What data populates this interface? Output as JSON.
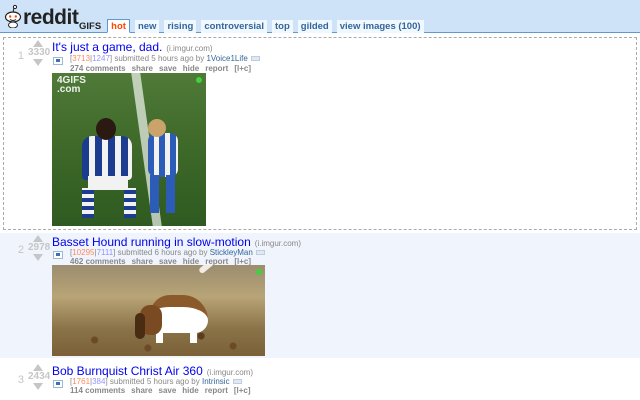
{
  "header": {
    "logo_text": "reddit",
    "subreddit": "GIFS",
    "tabs": [
      "hot",
      "new",
      "rising",
      "controversial",
      "top",
      "gilded",
      "view images (100)"
    ],
    "selected_tab": "hot"
  },
  "posts": [
    {
      "rank": "1",
      "score": "3330",
      "title": "It's just a game, dad.",
      "domain": "(i.imgur.com)",
      "ups": "3713",
      "downs": "1247",
      "submitted": "submitted 5 hours ago by",
      "author": "1Voice1Life",
      "comments": "274 comments",
      "watermark": "4GIFS\n.com",
      "image_icon": "soccer-players-image"
    },
    {
      "rank": "2",
      "score": "2978",
      "title": "Basset Hound running in slow-motion",
      "domain": "(i.imgur.com)",
      "ups": "10295",
      "downs": "7111",
      "submitted": "submitted 6 hours ago by",
      "author": "StickleyMan",
      "comments": "462 comments",
      "image_icon": "basset-hound-image"
    },
    {
      "rank": "3",
      "score": "2434",
      "title": "Bob Burnquist Christ Air 360",
      "domain": "(i.imgur.com)",
      "ups": "1761",
      "downs": "384",
      "submitted": "submitted 5 hours ago by",
      "author": "Intrinsic",
      "comments": "114 comments"
    }
  ],
  "actions": [
    "share",
    "save",
    "hide",
    "report",
    "[l+c]"
  ],
  "colors": {
    "header_bg": "#cee3f8",
    "selected_tab": "#ff4500",
    "link": "#0000ee",
    "highlight_row": "#f0f4fc"
  }
}
